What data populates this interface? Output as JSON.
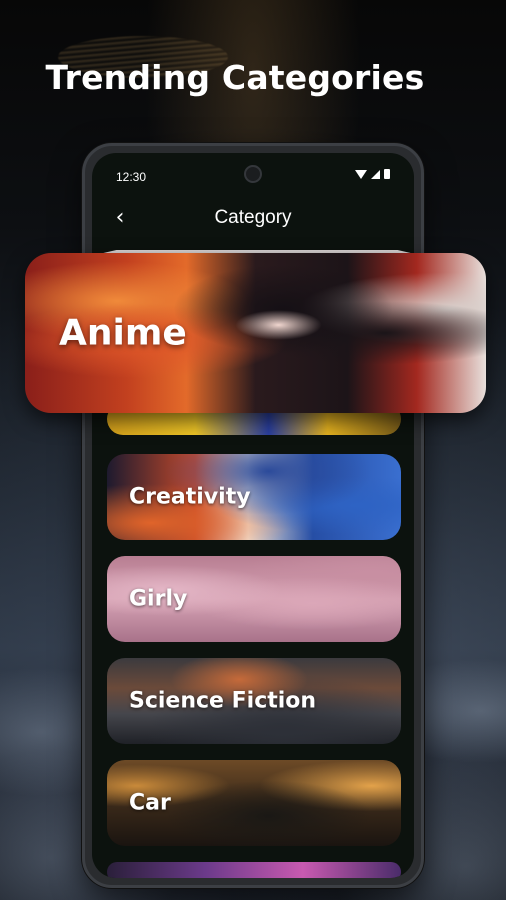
{
  "headline": "Trending Categories",
  "status_bar": {
    "time": "12:30",
    "icons": [
      "wifi-icon",
      "cell-signal-icon",
      "battery-icon"
    ]
  },
  "nav": {
    "back_icon": "chevron-left-icon",
    "back_glyph": "‹",
    "title": "Category"
  },
  "categories": [
    {
      "label": "Anime",
      "highlighted": true
    },
    {
      "label": "",
      "partial": true
    },
    {
      "label": "Creativity"
    },
    {
      "label": "Girly"
    },
    {
      "label": "Science Fiction"
    },
    {
      "label": "Car"
    }
  ],
  "colors": {
    "screen_background": "#0c120e",
    "text": "#ffffff"
  }
}
